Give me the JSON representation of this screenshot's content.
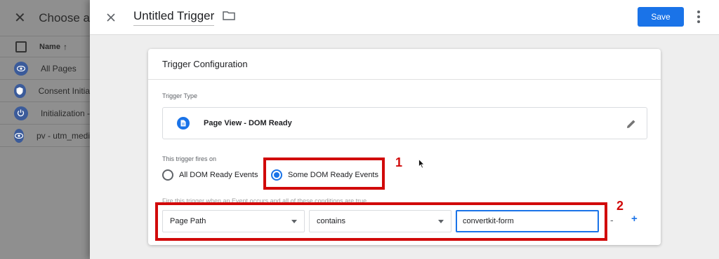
{
  "left_panel": {
    "title": "Choose a",
    "column_header": "Name",
    "sort_icon": "arrow-up-icon",
    "rows": [
      {
        "label": "All Pages",
        "icon": "eye-icon"
      },
      {
        "label": "Consent Initia",
        "icon": "shield-icon"
      },
      {
        "label": "Initialization -",
        "icon": "power-icon"
      },
      {
        "label": "pv - utm_medi",
        "icon": "eye-icon"
      }
    ]
  },
  "header": {
    "trigger_name": "Untitled Trigger",
    "save_label": "Save"
  },
  "card": {
    "title": "Trigger Configuration",
    "trigger_type_label": "Trigger Type",
    "trigger_type_value": "Page View - DOM Ready",
    "fires_on_label": "This trigger fires on",
    "option_all": "All DOM Ready Events",
    "option_some": "Some DOM Ready Events",
    "selected_option": "Some DOM Ready Events",
    "condition_label_partial": "Fire this trigger when an Event occurs and all of these conditions are true",
    "condition": {
      "variable": "Page Path",
      "operator": "contains",
      "value": "convertkit-form"
    },
    "minus_label": "-",
    "plus_label": "+"
  },
  "annotations": {
    "marker_1": "1",
    "marker_2": "2"
  },
  "colors": {
    "accent": "#1a73e8",
    "highlight": "#d10a0a"
  }
}
